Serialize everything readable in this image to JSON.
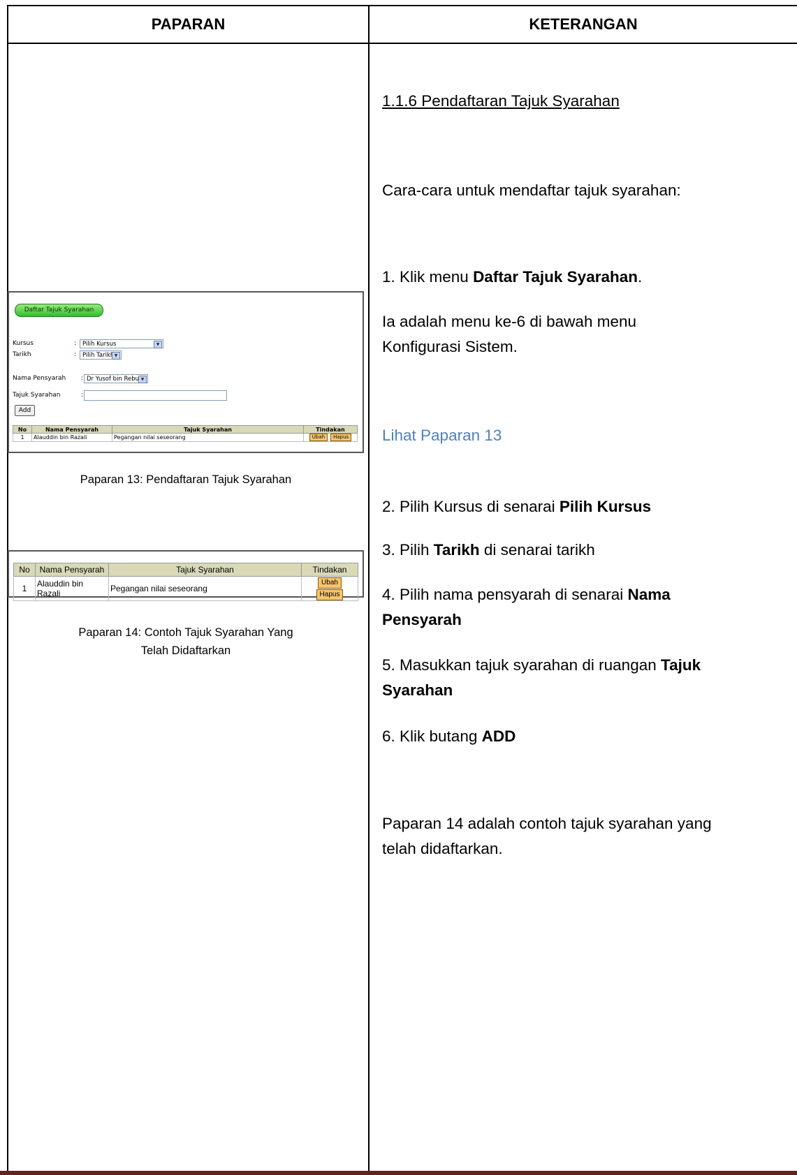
{
  "header": {
    "left": "PAPARAN",
    "right": "KETERANGAN"
  },
  "right": {
    "section_title": "1.1.6 Pendaftaran Tajuk Syarahan",
    "intro": "Cara-cara untuk mendaftar tajuk syarahan:",
    "step1_prefix": "1. Klik menu ",
    "step1_bold": "Daftar Tajuk Syarahan",
    "step1_suffix": ".",
    "step1_note": "Ia adalah menu ke-6 di bawah menu Konfigurasi Sistem.",
    "link": "Lihat Paparan 13",
    "step2_prefix": "2. Pilih Kursus di senarai ",
    "step2_bold": "Pilih Kursus",
    "step3_prefix": "3. Pilih ",
    "step3_bold": "Tarikh",
    "step3_suffix": " di senarai tarikh",
    "step4_prefix": "4. Pilih nama pensyarah di senarai ",
    "step4_bold": "Nama Pensyarah",
    "step5_prefix": "5. Masukkan tajuk syarahan di ruangan ",
    "step5_bold": "Tajuk Syarahan",
    "step6_prefix": "6. Klik butang ",
    "step6_bold": "ADD",
    "closing": "Paparan 14 adalah contoh tajuk syarahan yang telah didaftarkan."
  },
  "shot13": {
    "menu_button": "Daftar Tajuk Syarahan",
    "kursus_label": "Kursus",
    "kursus_value": "Pilih Kursus",
    "tarikh_label": "Tarikh",
    "tarikh_value": "Pilih Tarikh",
    "pensyarah_label": "Nama Pensyarah",
    "pensyarah_value": "Dr Yusof bin Rebu",
    "tajuk_label": "Tajuk Syarahan",
    "colon": ":",
    "add_button": "Add",
    "caption": "Paparan 13: Pendaftaran Tajuk Syarahan"
  },
  "table": {
    "columns": [
      "No",
      "Nama Pensyarah",
      "Tajuk Syarahan",
      "Tindakan"
    ],
    "rows": [
      {
        "no": "1",
        "nama": "Alauddin bin Razali",
        "tajuk": "Pegangan nilai seseorang"
      }
    ],
    "edit_button": "Ubah",
    "delete_button": "Hapus"
  },
  "shot14": {
    "caption_line1": "Paparan 14: Contoh Tajuk Syarahan Yang",
    "caption_line2": "Telah Didaftarkan"
  }
}
